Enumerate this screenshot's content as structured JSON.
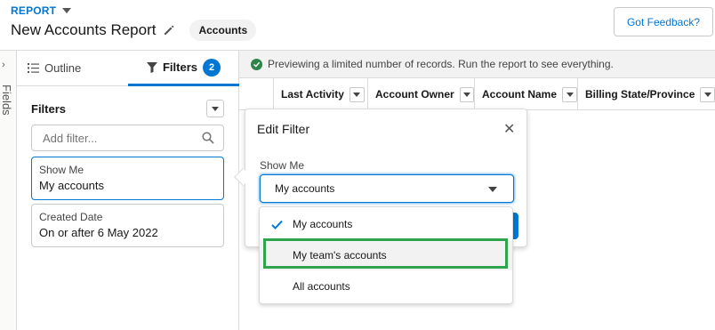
{
  "header": {
    "report_label": "REPORT",
    "title": "New Accounts Report",
    "type_pill": "Accounts",
    "feedback_button": "Got Feedback?"
  },
  "fields_strip": {
    "label": "Fields"
  },
  "panel": {
    "tabs": {
      "outline": "Outline",
      "filters": "Filters",
      "filters_count": "2"
    },
    "filters_heading": "Filters",
    "add_filter_placeholder": "Add filter...",
    "filters": [
      {
        "label": "Show Me",
        "value": "My accounts"
      },
      {
        "label": "Created Date",
        "value": "On or after 6 May 2022"
      }
    ]
  },
  "main": {
    "preview_message": "Previewing a limited number of records. Run the report to see everything.",
    "columns": [
      "Last Activity",
      "Account Owner",
      "Account Name",
      "Billing State/Province"
    ]
  },
  "edit_filter": {
    "title": "Edit Filter",
    "field_label": "Show Me",
    "selected_value": "My accounts",
    "options": [
      {
        "label": "My accounts",
        "checked": true
      },
      {
        "label": "My team's accounts",
        "checked": false
      },
      {
        "label": "All accounts",
        "checked": false
      }
    ]
  },
  "colors": {
    "brand": "#0176d3",
    "success": "#2e844a",
    "highlight_outline": "#2ea44f"
  }
}
